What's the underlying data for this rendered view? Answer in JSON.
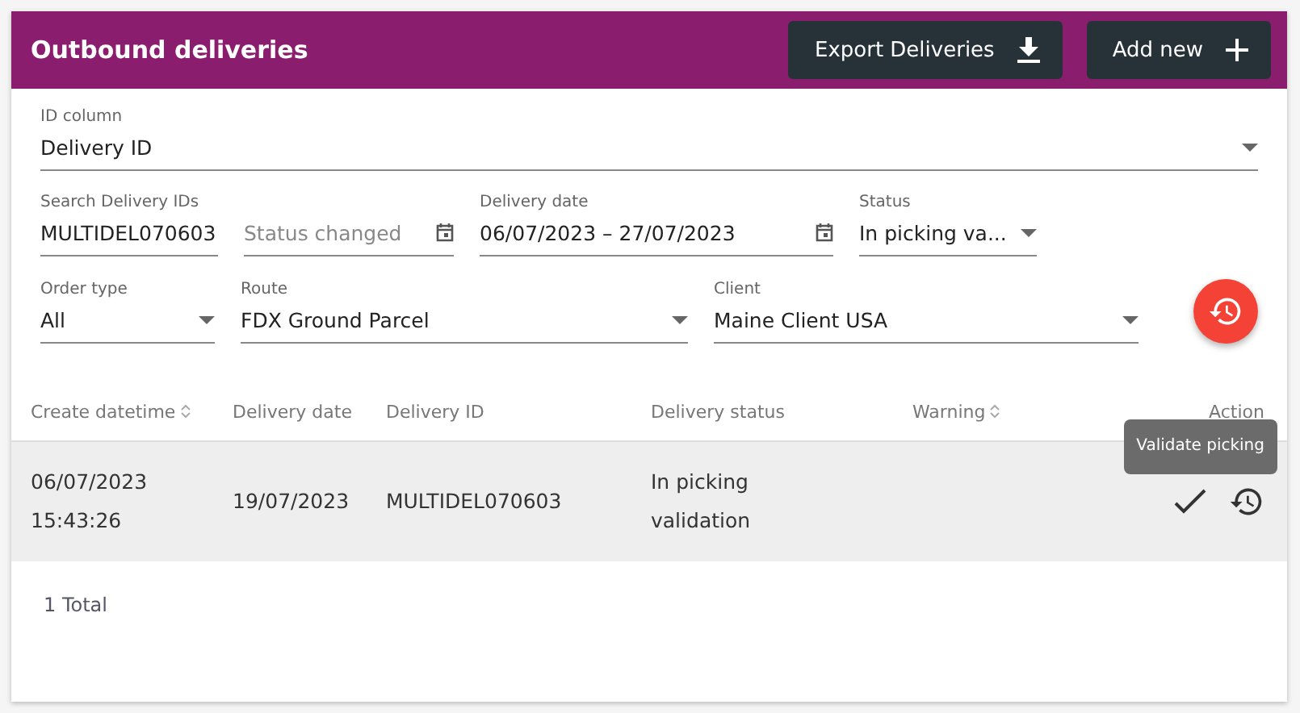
{
  "header": {
    "title": "Outbound deliveries",
    "buttons": [
      {
        "label": "Export Deliveries",
        "kind": "download"
      },
      {
        "label": "Add new",
        "kind": "add"
      }
    ]
  },
  "filter_rows": [
    [
      {
        "kind": "select",
        "label": "ID column",
        "value": "Delivery ID"
      }
    ],
    [
      {
        "kind": "text",
        "label": "Search Delivery IDs",
        "value": "MULTIDEL070603"
      },
      {
        "kind": "date",
        "placeholder": "Status changed"
      },
      {
        "kind": "date",
        "label": "Delivery date",
        "value": "06/07/2023 – 27/07/2023"
      },
      {
        "kind": "select",
        "label": "Status",
        "value": "In picking va..."
      }
    ],
    [
      {
        "kind": "select",
        "label": "Order type",
        "value": "All"
      },
      {
        "kind": "select",
        "label": "Route",
        "value": "FDX Ground Parcel"
      },
      {
        "kind": "select",
        "label": "Client",
        "value": "Maine Client USA"
      }
    ]
  ],
  "table": {
    "columns": [
      {
        "label": "Create datetime",
        "sortable": true
      },
      {
        "label": "Delivery date",
        "sortable": false
      },
      {
        "label": "Delivery ID",
        "sortable": false
      },
      {
        "label": "Delivery status",
        "sortable": false
      },
      {
        "label": "Warning",
        "sortable": true
      },
      {
        "label": "Action",
        "sortable": false
      }
    ],
    "rows": [
      {
        "selected": true,
        "create_datetime": [
          "06/07/2023",
          "15:43:26"
        ],
        "delivery_date": "19/07/2023",
        "delivery_id": "MULTIDEL070603",
        "status": "In picking validation",
        "tooltip": "Validate picking"
      }
    ]
  },
  "footer": {
    "total": "1 Total"
  }
}
